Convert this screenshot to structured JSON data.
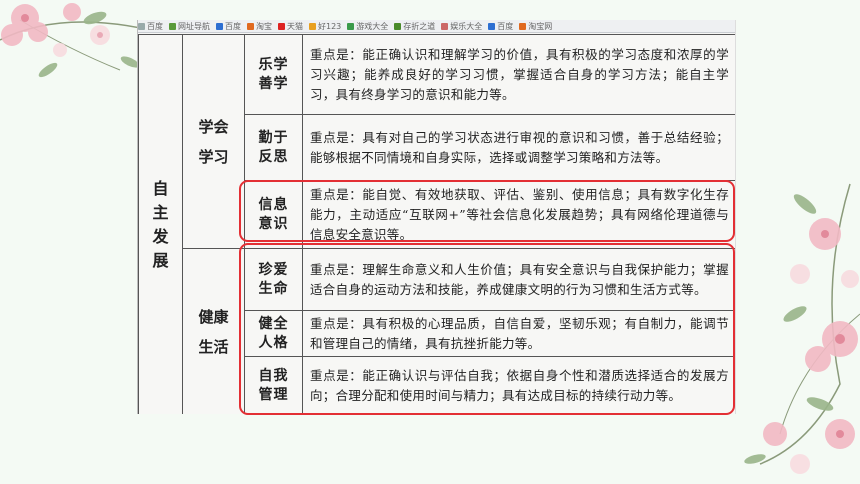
{
  "bookmarks": [
    "百度",
    "网址导航",
    "百度",
    "淘宝",
    "天猫",
    "好123",
    "游戏大全",
    "存折之道",
    "娱乐大全",
    "百度",
    "淘宝网"
  ],
  "table": {
    "main_category": "自主发展",
    "groups": [
      {
        "name": "学会学习",
        "items": [
          {
            "name": "乐学善学",
            "desc": "重点是：能正确认识和理解学习的价值，具有积极的学习态度和浓厚的学习兴趣；能养成良好的学习习惯，掌握适合自身的学习方法；能自主学习，具有终身学习的意识和能力等。"
          },
          {
            "name": "勤于反思",
            "desc": "重点是：具有对自己的学习状态进行审视的意识和习惯，善于总结经验；能够根据不同情境和自身实际，选择或调整学习策略和方法等。"
          },
          {
            "name": "信息意识",
            "desc": "重点是：能自觉、有效地获取、评估、鉴别、使用信息；具有数字化生存能力，主动适应“互联网+”等社会信息化发展趋势；具有网络伦理道德与信息安全意识等。"
          }
        ]
      },
      {
        "name": "健康生活",
        "items": [
          {
            "name": "珍爱生命",
            "desc": "重点是：理解生命意义和人生价值；具有安全意识与自我保护能力；掌握适合自身的运动方法和技能，养成健康文明的行为习惯和生活方式等。"
          },
          {
            "name": "健全人格",
            "desc": "重点是：具有积极的心理品质，自信自爱，坚韧乐观；有自制力，能调节和管理自己的情绪，具有抗挫折能力等。"
          },
          {
            "name": "自我管理",
            "desc": "重点是：能正确认识与评估自我；依据自身个性和潜质选择适合的发展方向；合理分配和使用时间与精力；具有达成目标的持续行动力等。"
          }
        ]
      }
    ]
  },
  "colors": {
    "highlight": "#e32f34",
    "background": "#f4faf4"
  }
}
